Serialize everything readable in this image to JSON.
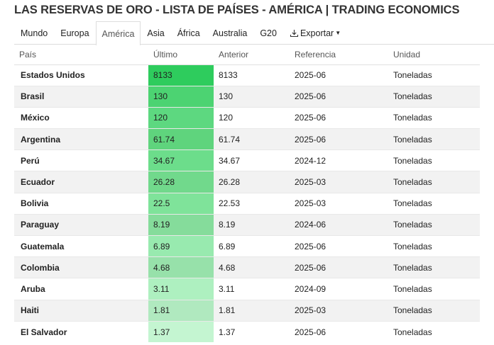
{
  "page": {
    "title": "LAS RESERVAS DE ORO - LISTA DE PAÍSES - AMÉRICA | TRADING ECONOMICS"
  },
  "tabs": [
    {
      "label": "Mundo",
      "active": false
    },
    {
      "label": "Europa",
      "active": false
    },
    {
      "label": "América",
      "active": true
    },
    {
      "label": "Asia",
      "active": false
    },
    {
      "label": "África",
      "active": false
    },
    {
      "label": "Australia",
      "active": false
    },
    {
      "label": "G20",
      "active": false
    }
  ],
  "export": {
    "label": "Exportar",
    "icon": "download-icon"
  },
  "table": {
    "headers": [
      "País",
      "Último",
      "Anterior",
      "Referencia",
      "Unidad"
    ],
    "rows": [
      {
        "country": "Estados Unidos",
        "last": "8133",
        "previous": "8133",
        "reference": "2025-06",
        "unit": "Toneladas",
        "heat": "#2ecc5d"
      },
      {
        "country": "Brasil",
        "last": "130",
        "previous": "130",
        "reference": "2025-06",
        "unit": "Toneladas",
        "heat": "#4cd372"
      },
      {
        "country": "México",
        "last": "120",
        "previous": "120",
        "reference": "2025-06",
        "unit": "Toneladas",
        "heat": "#5dd880"
      },
      {
        "country": "Argentina",
        "last": "61.74",
        "previous": "61.74",
        "reference": "2025-06",
        "unit": "Toneladas",
        "heat": "#5fd47d"
      },
      {
        "country": "Perú",
        "last": "34.67",
        "previous": "34.67",
        "reference": "2024-12",
        "unit": "Toneladas",
        "heat": "#6cdd8b"
      },
      {
        "country": "Ecuador",
        "last": "26.28",
        "previous": "26.28",
        "reference": "2025-03",
        "unit": "Toneladas",
        "heat": "#71d98c"
      },
      {
        "country": "Bolivia",
        "last": "22.5",
        "previous": "22.53",
        "reference": "2025-03",
        "unit": "Toneladas",
        "heat": "#7fe39a"
      },
      {
        "country": "Paraguay",
        "last": "8.19",
        "previous": "8.19",
        "reference": "2024-06",
        "unit": "Toneladas",
        "heat": "#85dc9b"
      },
      {
        "country": "Guatemala",
        "last": "6.89",
        "previous": "6.89",
        "reference": "2025-06",
        "unit": "Toneladas",
        "heat": "#98eaaf"
      },
      {
        "country": "Colombia",
        "last": "4.68",
        "previous": "4.68",
        "reference": "2025-06",
        "unit": "Toneladas",
        "heat": "#97e1aa"
      },
      {
        "country": "Aruba",
        "last": "3.11",
        "previous": "3.11",
        "reference": "2024-09",
        "unit": "Toneladas",
        "heat": "#aef0c0"
      },
      {
        "country": "Haiti",
        "last": "1.81",
        "previous": "1.81",
        "reference": "2025-03",
        "unit": "Toneladas",
        "heat": "#b0e9bf"
      },
      {
        "country": "El Salvador",
        "last": "1.37",
        "previous": "1.37",
        "reference": "2025-06",
        "unit": "Toneladas",
        "heat": "#c4f5d1"
      }
    ]
  }
}
